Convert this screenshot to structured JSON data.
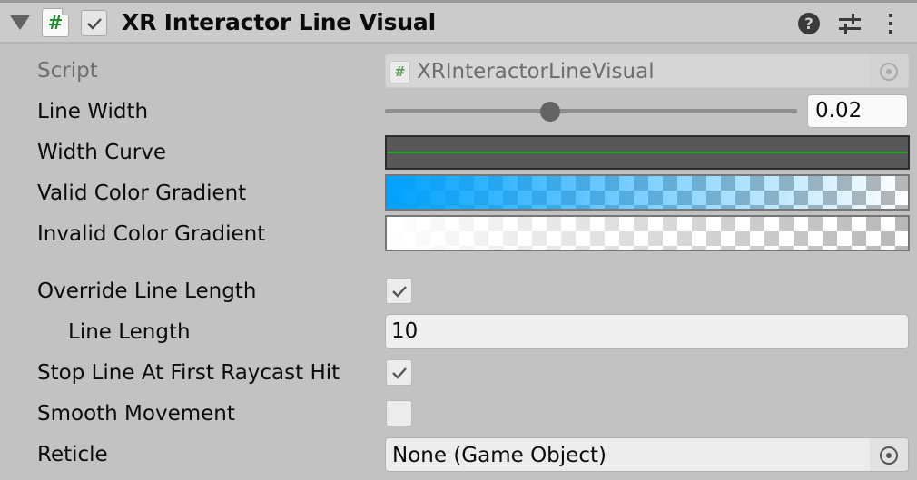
{
  "component": {
    "title": "XR Interactor Line Visual",
    "enabled": true,
    "expanded": true,
    "header_icons": [
      "help-icon",
      "presets-icon",
      "kebab-menu-icon"
    ]
  },
  "properties": {
    "script": {
      "label": "Script",
      "value": "XRInteractorLineVisual",
      "icon": "script-icon",
      "disabled": true
    },
    "line_width": {
      "label": "Line Width",
      "value": "0.02",
      "slider_fraction": 0.4
    },
    "width_curve": {
      "label": "Width Curve",
      "curve_color": "#1ea81e",
      "background": "#575757"
    },
    "valid_color_gradient": {
      "label": "Valid Color Gradient",
      "start_color": "#00a2ff",
      "start_alpha": 1.0,
      "end_alpha": 0.0
    },
    "invalid_color_gradient": {
      "label": "Invalid Color Gradient",
      "start_color": "#ffffff",
      "start_alpha": 1.0,
      "end_alpha": 0.0
    },
    "override_line_length": {
      "label": "Override Line Length",
      "checked": true
    },
    "line_length": {
      "label": "Line Length",
      "value": "10"
    },
    "stop_line_at_first_raycast_hit": {
      "label": "Stop Line At First Raycast Hit",
      "checked": true
    },
    "smooth_movement": {
      "label": "Smooth Movement",
      "checked": false
    },
    "reticle": {
      "label": "Reticle",
      "value": "None (Game Object)"
    }
  }
}
